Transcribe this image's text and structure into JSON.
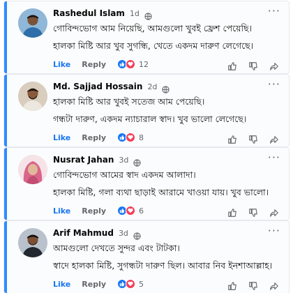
{
  "comments": [
    {
      "author": "Rashedul Islam",
      "time": "1d",
      "line1": "গোবিন্দভোগ আম নিয়েছি, আমগুলো খুবই ফ্রেশ পেয়েছি।",
      "line2": "হালকা মিষ্টি আর খুব সুগন্ধি, খেতে একদম দারুণ লেগেছে।",
      "like_label": "Like",
      "reply_label": "Reply",
      "reaction_count": "12",
      "avatar_bg": "#2e6fa8"
    },
    {
      "author": "Md. Sajjad Hossain",
      "time": "2d",
      "line1": "হালকা মিষ্টি আর খুবই সতেজ আম পেয়েছি।",
      "line2": "গন্ধটা দারুণ, একদম ন্যাচারাল স্বাদ। খুব ভালো লেগেছে।",
      "like_label": "Like",
      "reply_label": "Reply",
      "reaction_count": "8",
      "avatar_bg": "#c9b7a0"
    },
    {
      "author": "Nusrat Jahan",
      "time": "3d",
      "line1": "গোবিন্দভোগ আমের স্বাদ একদম আলাদা।",
      "line2": "হালকা মিষ্টি, গলা ব্যথা ছাড়াই আরামে খাওয়া যায়। খুব ভালো।",
      "like_label": "Like",
      "reply_label": "Reply",
      "reaction_count": "6",
      "avatar_bg": "#f2c9d3"
    },
    {
      "author": "Arif Mahmud",
      "time": "3d",
      "line1": "আমগুলো দেখতে সুন্দর এবং টাটকা।",
      "line2": "স্বাদে হালকা মিষ্টি, সুগন্ধটা দারুণ ছিল। আবার নিব ইনশাআল্লাহ।",
      "like_label": "Like",
      "reply_label": "Reply",
      "reaction_count": "5",
      "avatar_bg": "#3a3f4a"
    }
  ],
  "colors": {
    "accent_border": "#2d8cff",
    "like_blue": "#1877f2",
    "love_red": "#f33e58",
    "meta_gray": "#65676b"
  },
  "icons": {
    "privacy": "globe-icon",
    "menu": "more-options-icon",
    "like_action": "thumbs-up-icon",
    "dislike_action": "thumbs-down-icon",
    "share_action": "share-icon"
  }
}
